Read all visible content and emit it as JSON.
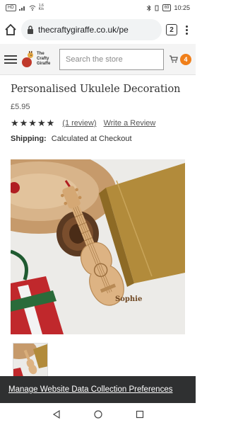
{
  "status_bar": {
    "left_badge": "HD",
    "speed_top": "1.6",
    "speed_bottom": "K/s",
    "battery": "69",
    "time": "10:25"
  },
  "browser": {
    "url": "thecraftygiraffe.co.uk/pe",
    "tab_count": "2"
  },
  "site_header": {
    "logo_text_1": "The",
    "logo_text_2": "Crafty",
    "logo_text_3": "Giraffe",
    "search_placeholder": "Search the store",
    "cart_count": "4"
  },
  "product": {
    "title": "Personalised Ukulele Decoration",
    "price": "£5.95",
    "stars": "★★★★★",
    "rating_value": 5,
    "review_link": "(1 review)",
    "write_review": "Write a Review",
    "shipping_label": "Shipping:",
    "shipping_value": "Calculated at Checkout",
    "engraved_name": "Sophie"
  },
  "cookie_banner": {
    "link": "Manage Website Data Collection Preferences"
  },
  "colors": {
    "accent": "#f07f1a",
    "header_bg": "#f4f4f4",
    "banner_bg": "#2f3031"
  },
  "icons": [
    "home-icon",
    "lock-icon",
    "tabs-icon",
    "more-icon",
    "menu-icon",
    "cart-icon",
    "back-icon",
    "home-nav-icon",
    "recents-icon"
  ]
}
